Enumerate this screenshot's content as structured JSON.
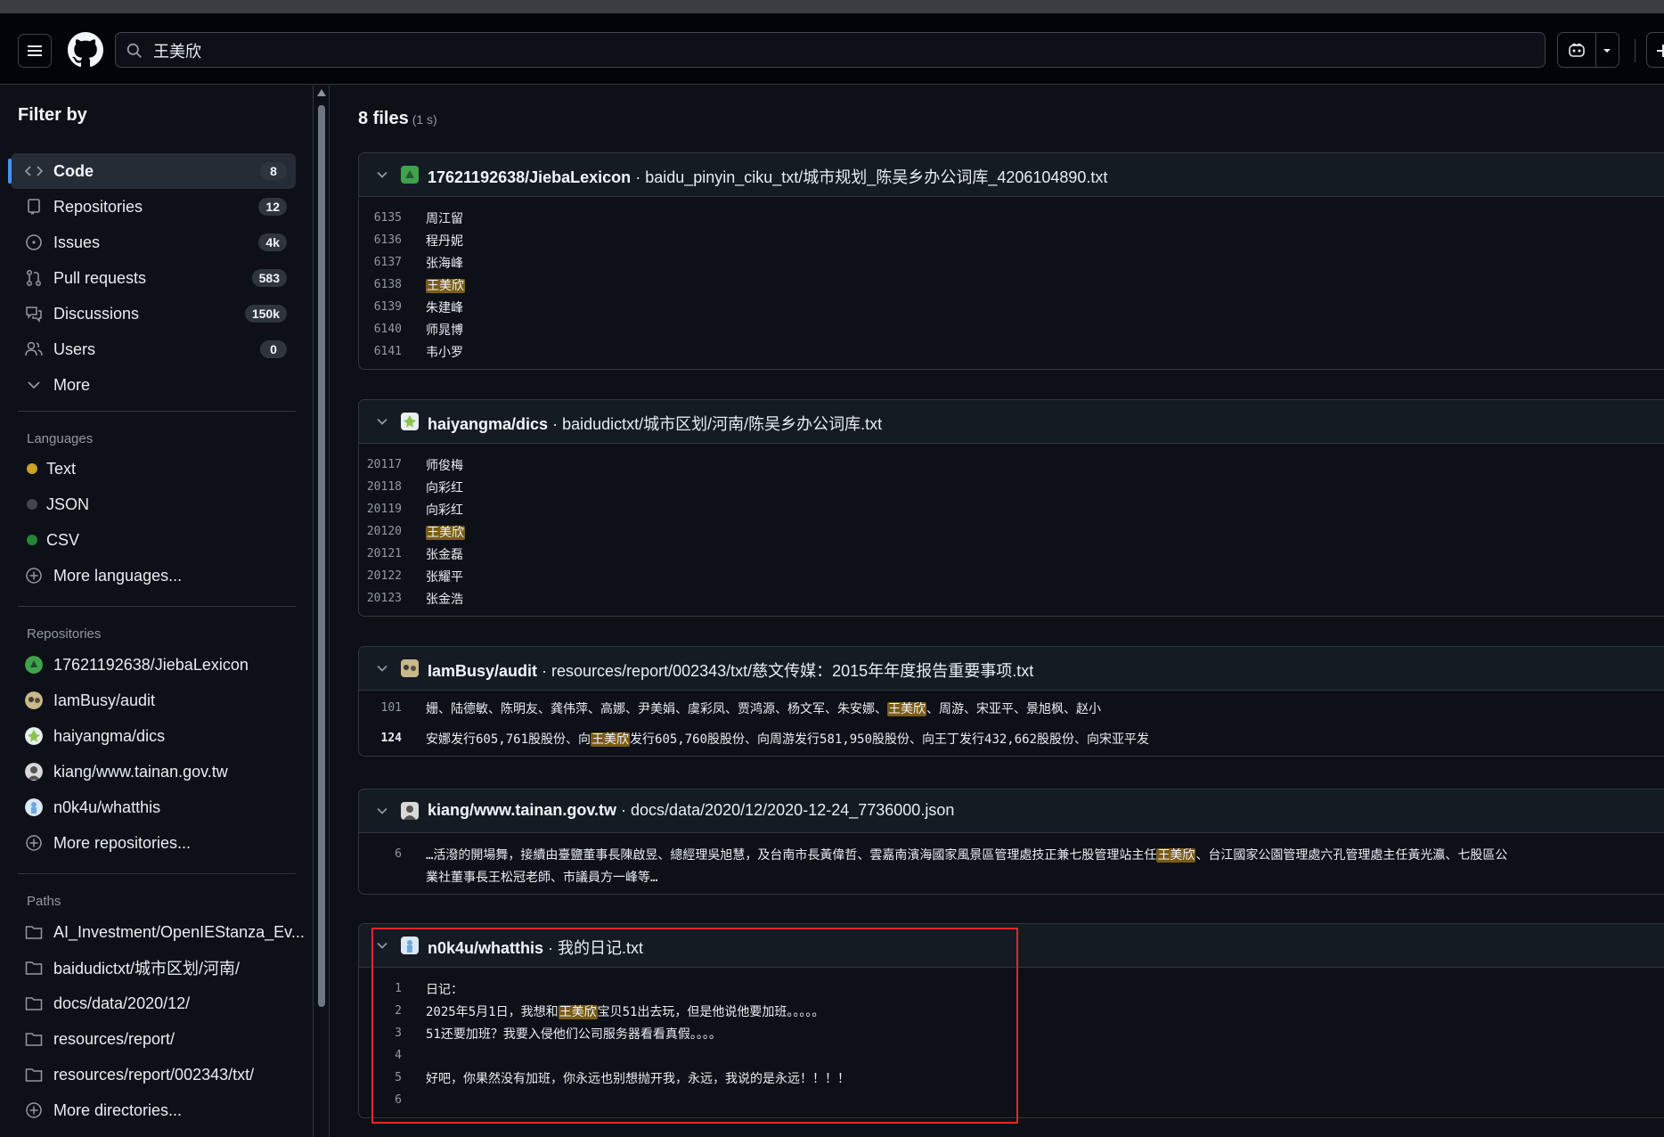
{
  "search": {
    "query": "王美欣",
    "placeholder": ""
  },
  "sidebar": {
    "title": "Filter by",
    "nav": [
      {
        "label": "Code",
        "count": "8",
        "icon": "code-icon",
        "active": true
      },
      {
        "label": "Repositories",
        "count": "12",
        "icon": "repo-icon"
      },
      {
        "label": "Issues",
        "count": "4k",
        "icon": "issue-icon"
      },
      {
        "label": "Pull requests",
        "count": "583",
        "icon": "pull-request-icon"
      },
      {
        "label": "Discussions",
        "count": "150k",
        "icon": "discussion-icon"
      },
      {
        "label": "Users",
        "count": "0",
        "icon": "users-icon"
      },
      {
        "label": "More",
        "count": "",
        "icon": "chevron-down-icon"
      }
    ],
    "languages": {
      "title": "Languages",
      "items": [
        {
          "label": "Text",
          "color": "#c9a227"
        },
        {
          "label": "JSON",
          "color": "#40464e"
        },
        {
          "label": "CSV",
          "color": "#238636"
        }
      ],
      "more": "More languages..."
    },
    "repositories": {
      "title": "Repositories",
      "items": [
        {
          "label": "17621192638/JiebaLexicon"
        },
        {
          "label": "IamBusy/audit"
        },
        {
          "label": "haiyangma/dics"
        },
        {
          "label": "kiang/www.tainan.gov.tw"
        },
        {
          "label": "n0k4u/whatthis"
        }
      ],
      "more": "More repositories..."
    },
    "paths": {
      "title": "Paths",
      "items": [
        {
          "label": "AI_Investment/OpenIEStanza_Ev..."
        },
        {
          "label": "baidudictxt/城市区划/河南/"
        },
        {
          "label": "docs/data/2020/12/"
        },
        {
          "label": "resources/report/"
        },
        {
          "label": "resources/report/002343/txt/"
        }
      ],
      "more": "More directories..."
    }
  },
  "results": {
    "count_label": "8 files",
    "time_label": "(1 s)",
    "cards": [
      {
        "repo": "17621192638/JiebaLexicon",
        "sep": " · ",
        "path": "baidu_pinyin_ciku_txt/城市规划_陈吴乡办公词库_4206104890.txt",
        "lines": [
          {
            "num": "6135",
            "pre": "周江留",
            "hit": "",
            "post": ""
          },
          {
            "num": "6136",
            "pre": "程丹妮",
            "hit": "",
            "post": ""
          },
          {
            "num": "6137",
            "pre": "张海峰",
            "hit": "",
            "post": ""
          },
          {
            "num": "6138",
            "pre": "",
            "hit": "王美欣",
            "post": ""
          },
          {
            "num": "6139",
            "pre": "朱建峰",
            "hit": "",
            "post": ""
          },
          {
            "num": "6140",
            "pre": "师晁博",
            "hit": "",
            "post": ""
          },
          {
            "num": "6141",
            "pre": "韦小罗",
            "hit": "",
            "post": ""
          }
        ]
      },
      {
        "repo": "haiyangma/dics",
        "sep": " · ",
        "path": "baidudictxt/城市区划/河南/陈吴乡办公词库.txt",
        "lines": [
          {
            "num": "20117",
            "pre": "师俊梅",
            "hit": "",
            "post": ""
          },
          {
            "num": "20118",
            "pre": "向彩红",
            "hit": "",
            "post": ""
          },
          {
            "num": "20119",
            "pre": "向彩红",
            "hit": "",
            "post": ""
          },
          {
            "num": "20120",
            "pre": "",
            "hit": "王美欣",
            "post": ""
          },
          {
            "num": "20121",
            "pre": "张金磊",
            "hit": "",
            "post": ""
          },
          {
            "num": "20122",
            "pre": "张耀平",
            "hit": "",
            "post": ""
          },
          {
            "num": "20123",
            "pre": "张金浩",
            "hit": "",
            "post": ""
          }
        ]
      },
      {
        "repo": "IamBusy/audit",
        "sep": " · ",
        "path": "resources/report/002343/txt/慈文传媒：2015年年度报告重要事项.txt",
        "lines": [
          {
            "num": "101",
            "pre": "姗、陆德敏、陈明友、龚伟萍、高娜、尹美娟、虞彩凤、贾鸿源、杨文军、朱安娜、",
            "hit": "王美欣",
            "post": "、周游、宋亚平、景旭枫、赵小"
          },
          {
            "num": "124",
            "bold": true,
            "pre": "安娜发行605,761股股份、向",
            "hit": "王美欣",
            "post": "发行605,760股股份、向周游发行581,950股股份、向王丁发行432,662股股份、向宋亚平发"
          }
        ]
      },
      {
        "repo": "kiang/www.tainan.gov.tw",
        "sep": " · ",
        "path": "docs/data/2020/12/2020-12-24_7736000.json",
        "lines": [
          {
            "num": "6",
            "pre": "…活潑的開場舞，接續由臺鹽董事長陳啟昱、總經理吳旭慧，及台南市長黃偉哲、雲嘉南濱海國家風景區管理處技正兼七股管理站主任",
            "hit": "王美欣",
            "post": "、台江國家公園管理處六孔管理處主任黃光瀛、七股區公"
          },
          {
            "num": "",
            "pre": "業社董事長王松冠老師、市議員方一峰等…",
            "hit": "",
            "post": ""
          }
        ]
      },
      {
        "repo": "n0k4u/whatthis",
        "sep": " · ",
        "path": "我的日记.txt",
        "lines": [
          {
            "num": "1",
            "pre": "日记：",
            "hit": "",
            "post": ""
          },
          {
            "num": "2",
            "pre": "2025年5月1日，我想和",
            "hit": "王美欣",
            "post": "宝贝51出去玩，但是他说他要加班。。。。。"
          },
          {
            "num": "3",
            "pre": "51还要加班？我要入侵他们公司服务器看看真假。。。。",
            "hit": "",
            "post": ""
          },
          {
            "num": "4",
            "pre": "",
            "hit": "",
            "post": ""
          },
          {
            "num": "5",
            "pre": "好吧，你果然没有加班，你永远也别想抛开我，永远，我说的是永远！！！！",
            "hit": "",
            "post": ""
          },
          {
            "num": "6",
            "pre": "",
            "hit": "",
            "post": ""
          }
        ]
      }
    ]
  }
}
